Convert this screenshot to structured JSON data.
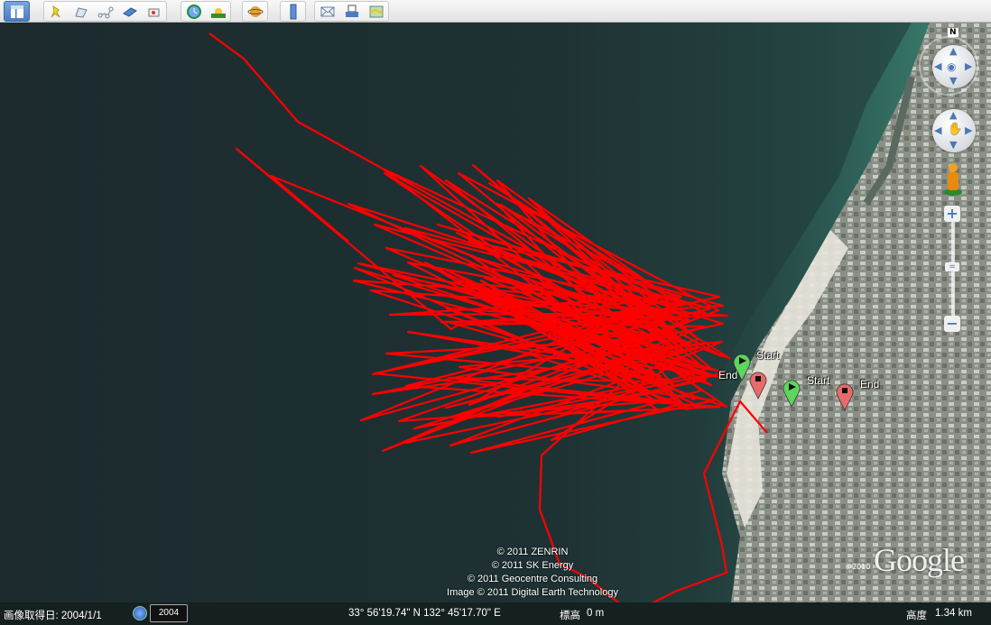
{
  "toolbar": {
    "buttons": [
      {
        "name": "sidebar-toggle",
        "icon": "sidebar-icon"
      },
      {
        "name": "add-placemark",
        "icon": "pushpin-icon"
      },
      {
        "name": "add-polygon",
        "icon": "polygon-icon"
      },
      {
        "name": "add-path",
        "icon": "path-icon"
      },
      {
        "name": "add-image-overlay",
        "icon": "image-overlay-icon"
      },
      {
        "name": "record-tour",
        "icon": "tour-icon"
      },
      {
        "name": "historical-imagery",
        "icon": "clock-icon"
      },
      {
        "name": "sunlight",
        "icon": "sun-icon"
      },
      {
        "name": "switch-planet",
        "icon": "planet-icon"
      },
      {
        "name": "ruler",
        "icon": "ruler-icon"
      },
      {
        "name": "email",
        "icon": "envelope-icon"
      },
      {
        "name": "print",
        "icon": "printer-icon"
      },
      {
        "name": "view-in-maps",
        "icon": "map-icon"
      }
    ]
  },
  "map": {
    "track_color": "#ff0000",
    "markers": [
      {
        "type": "start",
        "label": "Start",
        "color": "#5cd65c"
      },
      {
        "type": "end",
        "label": "End",
        "color": "#e86a6a"
      },
      {
        "type": "start",
        "label": "Start",
        "color": "#5cd65c"
      },
      {
        "type": "end",
        "label": "End",
        "color": "#e86a6a"
      }
    ],
    "compass_label": "N",
    "copyright": [
      "© 2011 ZENRIN",
      "© 2011 SK Energy",
      "© 2011 Geocentre Consulting",
      "Image © 2011 Digital Earth Technology"
    ],
    "logo": "Google",
    "logo_year": "©2010"
  },
  "status": {
    "imagery_date": "画像取得日: 2004/1/1",
    "year_button": "2004",
    "coordinates": "33° 56'19.74\" N 132° 45'17.70\" E",
    "elevation_label": "標高",
    "elevation_value": "0 m",
    "altitude_label": "高度",
    "altitude_value": "1.34 km"
  }
}
